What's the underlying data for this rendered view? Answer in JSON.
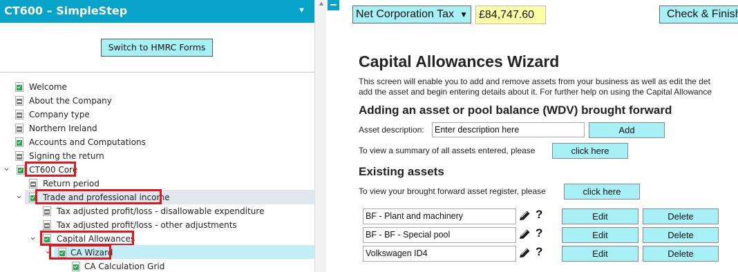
{
  "sidebar": {
    "title": "CT600 – SimpleStep",
    "switch_button": "Switch to HMRC Forms",
    "tree": [
      {
        "label": "Welcome",
        "status": "complete"
      },
      {
        "label": "About the Company",
        "status": "minus"
      },
      {
        "label": "Company type",
        "status": "minus"
      },
      {
        "label": "Northern Ireland",
        "status": "minus"
      },
      {
        "label": "Accounts and Computations",
        "status": "complete"
      },
      {
        "label": "Signing the return",
        "status": "minus"
      },
      {
        "label": "CT600 Core",
        "status": "complete",
        "expanded": true,
        "highlighted": true
      },
      {
        "label": "Return period",
        "status": "minus"
      },
      {
        "label": "Trade and professional income",
        "status": "complete",
        "expanded": true,
        "highlighted": true
      },
      {
        "label": "Tax adjusted profit/loss - disallowable expenditure",
        "status": "minus"
      },
      {
        "label": "Tax adjusted profit/loss - other adjustments",
        "status": "minus"
      },
      {
        "label": "Capital Allowances",
        "status": "complete",
        "expanded": true,
        "highlighted": true
      },
      {
        "label": "CA Wizard",
        "status": "complete",
        "expanded": true,
        "highlighted": true,
        "selected": true
      },
      {
        "label": "CA Calculation Grid",
        "status": "complete"
      }
    ]
  },
  "toolbar": {
    "tax_select": "Net Corporation Tax",
    "tax_value": "£84,747.60",
    "check_finish": "Check & Finish"
  },
  "main": {
    "title": "Capital Allowances Wizard",
    "intro_line1": "This screen will enable you to add and remove assets from your business as well as edit the det",
    "intro_line2": "add the asset and begin entering details about it. For further help on using the Capital Allowance",
    "add_heading": "Adding an asset or pool balance (WDV) brought forward",
    "asset_desc_label": "Asset description:",
    "asset_desc_value": "Enter description here",
    "add_button": "Add",
    "summary_text": "To view a summary of all assets entered, please",
    "summary_button": "click here",
    "existing_heading": "Existing assets",
    "register_text": "To view your brought forward asset register, please",
    "register_button": "click here",
    "assets": [
      {
        "name": "BF - Plant and machinery"
      },
      {
        "name": "BF - BF - Special pool"
      },
      {
        "name": "Volkswagen ID4"
      }
    ],
    "edit_label": "Edit",
    "delete_label": "Delete",
    "help_glyph": "?"
  }
}
